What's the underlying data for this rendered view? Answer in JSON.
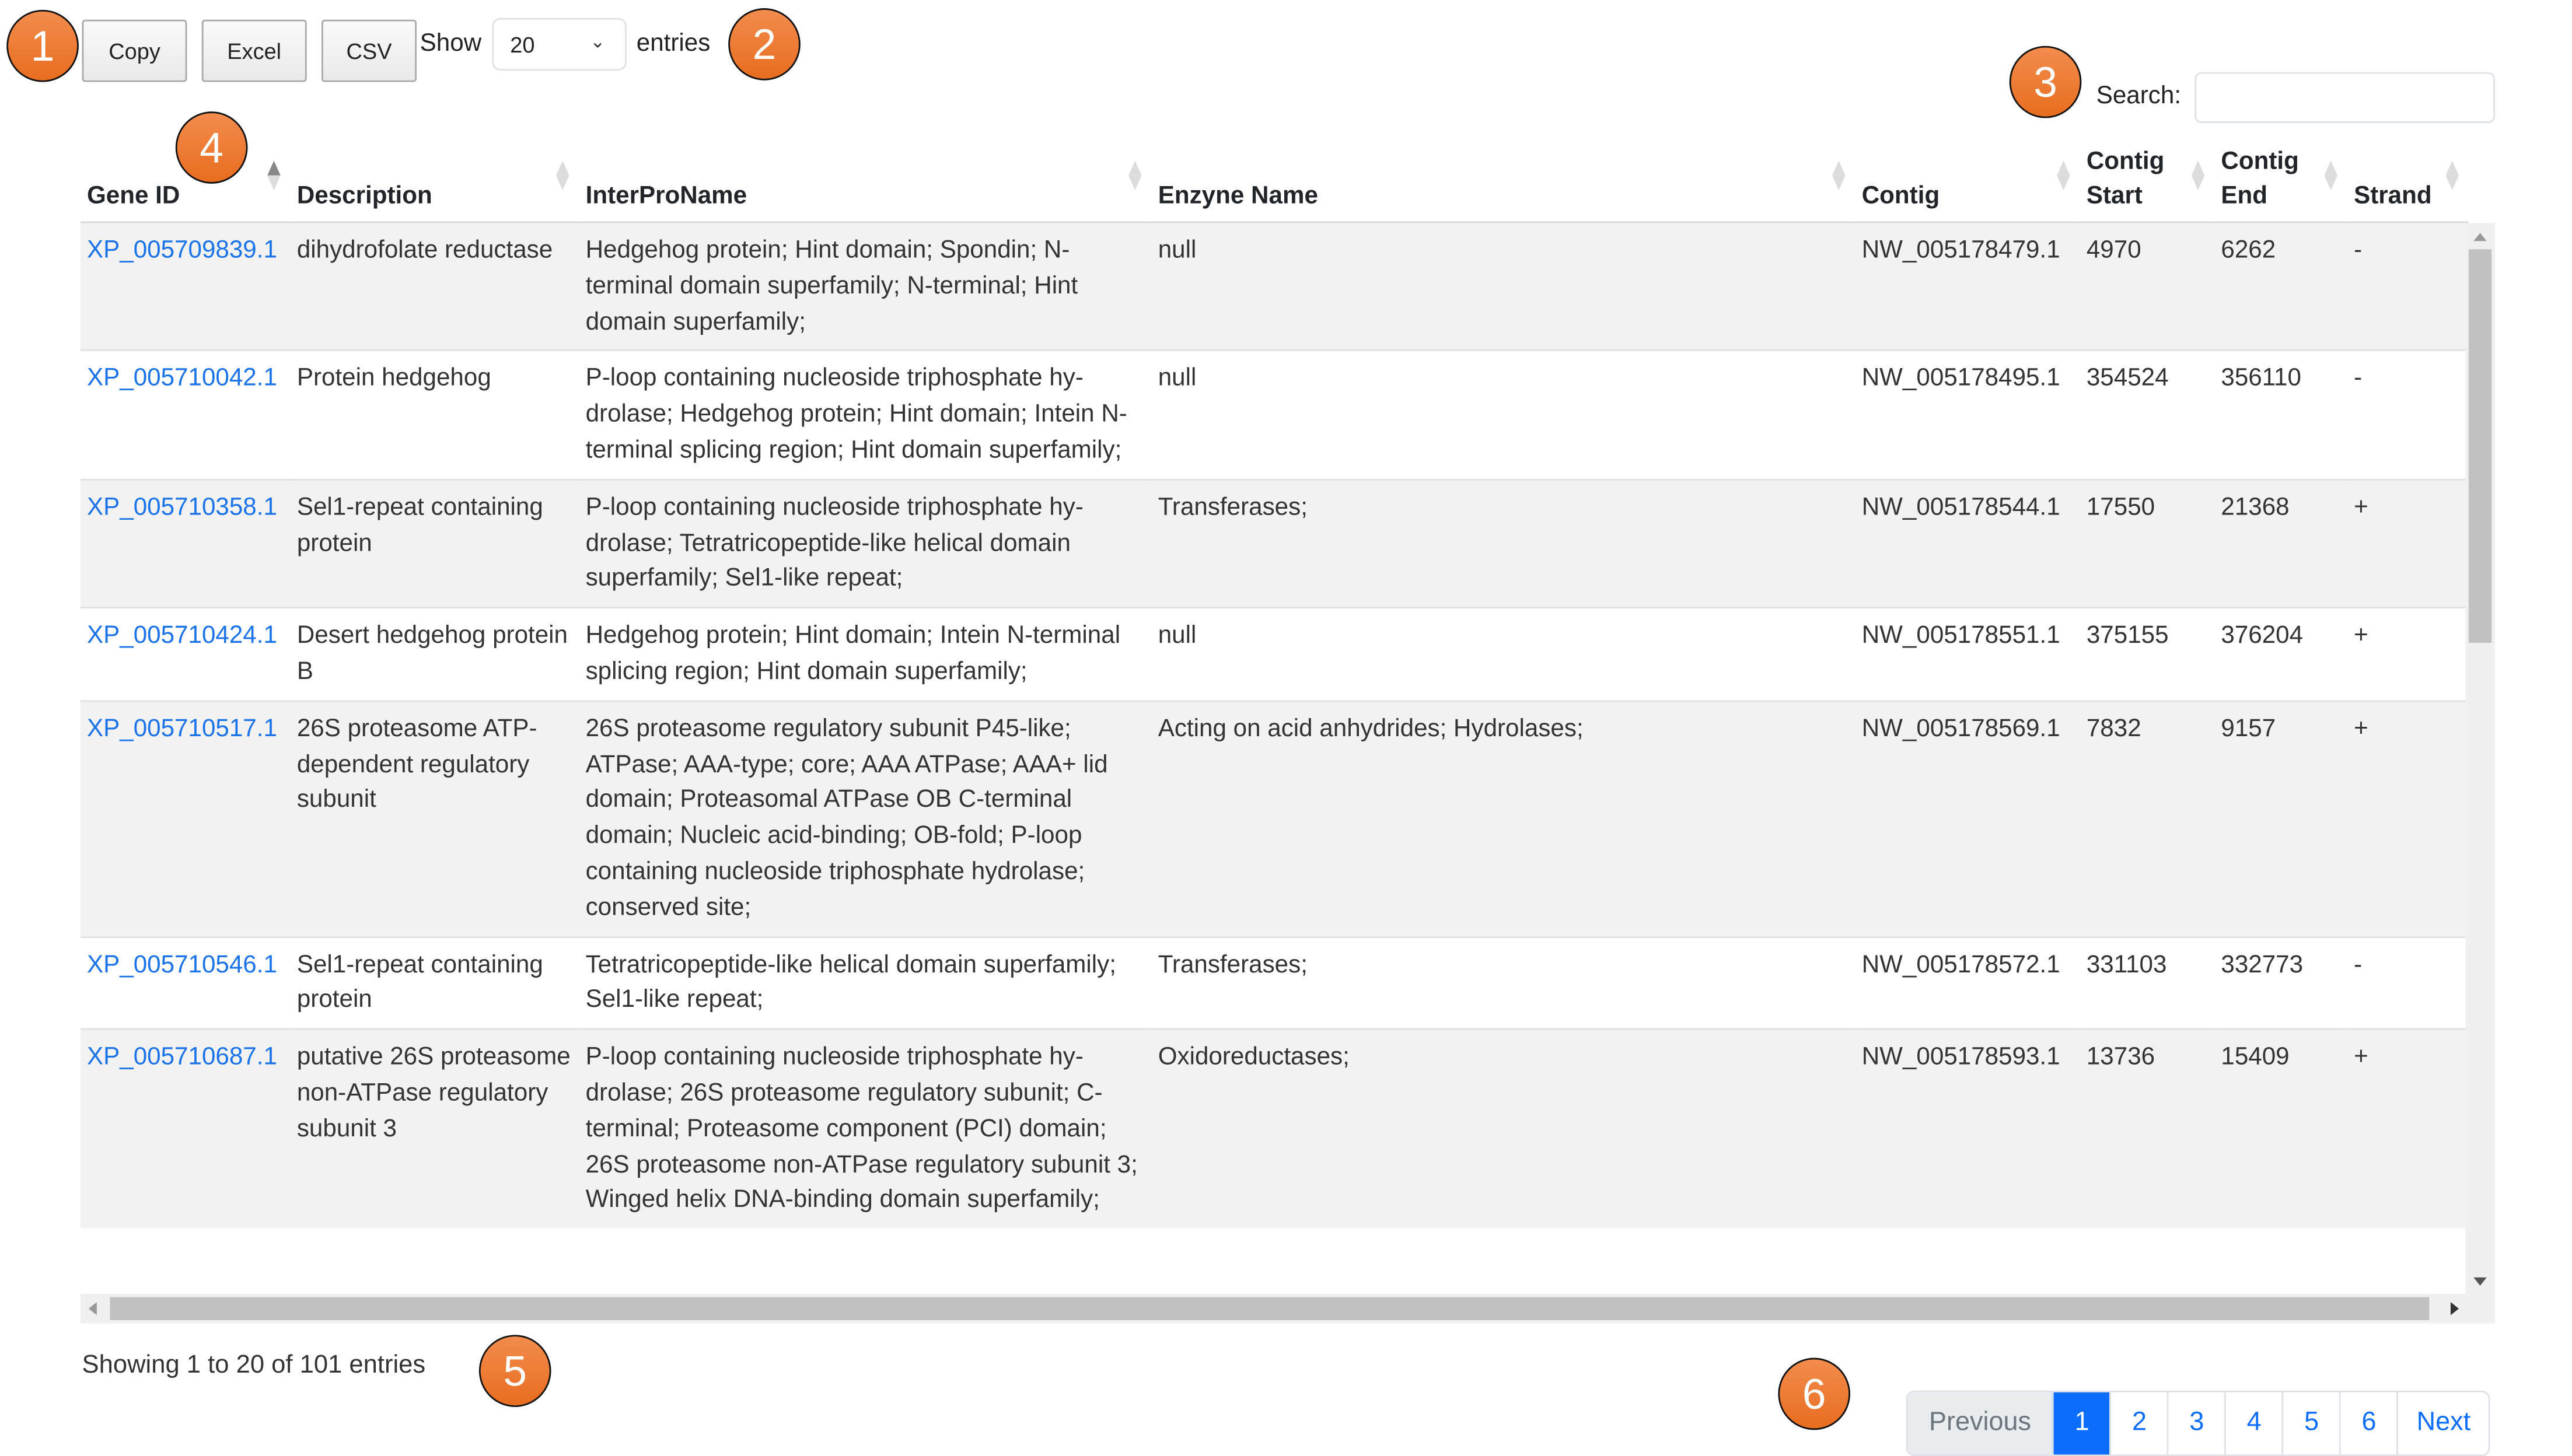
{
  "toolbar": {
    "buttons": [
      {
        "label": "Copy"
      },
      {
        "label": "Excel"
      },
      {
        "label": "CSV"
      }
    ],
    "show_label": "Show",
    "page_length_value": "20",
    "entries_label": "entries",
    "search_label": "Search:",
    "search_value": ""
  },
  "callouts": [
    "1",
    "2",
    "3",
    "4",
    "5",
    "6"
  ],
  "table": {
    "columns": [
      {
        "label": "Gene ID",
        "sort": "ascending"
      },
      {
        "label": "Description",
        "sort": "none"
      },
      {
        "label": "InterProName",
        "sort": "none"
      },
      {
        "label": "Enzyne Name",
        "sort": "none"
      },
      {
        "label": "Contig",
        "sort": "none"
      },
      {
        "label": "Contig Start",
        "sort": "none"
      },
      {
        "label": "Contig End",
        "sort": "none"
      },
      {
        "label": "Strand",
        "sort": "none"
      }
    ],
    "rows": [
      {
        "gene_id": "XP_005709839.1",
        "description": "dihydrofolate reductase",
        "interpro": "Hedgehog protein; Hint domain; Spondin; N-terminal domain superfamily; N-terminal; Hint domain superfamily;",
        "enzyme": "null",
        "contig": "NW_005178479.1",
        "start": "4970",
        "end": "6262",
        "strand": "-"
      },
      {
        "gene_id": "XP_005710042.1",
        "description": "Protein hedgehog",
        "interpro": "P-loop containing nucleoside triphosphate hy­drolase; Hedgehog protein; Hint domain; Intein N-terminal splicing region; Hint domain superfamily;",
        "enzyme": "null",
        "contig": "NW_005178495.1",
        "start": "354524",
        "end": "356110",
        "strand": "-"
      },
      {
        "gene_id": "XP_005710358.1",
        "description": "Sel1-repeat containing protein",
        "interpro": "P-loop containing nucleoside triphosphate hy­drolase; Tetratricopeptide-like helical domain superfamily; Sel1-like repeat;",
        "enzyme": "Transferases;",
        "contig": "NW_005178544.1",
        "start": "17550",
        "end": "21368",
        "strand": "+"
      },
      {
        "gene_id": "XP_005710424.1",
        "description": "Desert hedgehog pro­tein B",
        "interpro": "Hedgehog protein; Hint domain; Intein N-ter­minal splicing region; Hint domain superfamily;",
        "enzyme": "null",
        "contig": "NW_005178551.1",
        "start": "375155",
        "end": "376204",
        "strand": "+"
      },
      {
        "gene_id": "XP_005710517.1",
        "description": "26S proteasome ATP-dependent regulatory subunit",
        "interpro": "26S proteasome regulatory subunit P45-like; ATPase; AAA-type; core; AAA ATPase; AAA+ lid domain; Proteasomal ATPase OB C-terminal domain; Nucleic acid-binding; OB-fold; P-loop containing nucleoside triphosphate hydrolase; conserved site;",
        "enzyme": "Acting on acid anhydrides; Hydrolases;",
        "contig": "NW_005178569.1",
        "start": "7832",
        "end": "9157",
        "strand": "+"
      },
      {
        "gene_id": "XP_005710546.1",
        "description": "Sel1-repeat containing protein",
        "interpro": "Tetratricopeptide-like helical domain super­family; Sel1-like repeat;",
        "enzyme": "Transferases;",
        "contig": "NW_005178572.1",
        "start": "331103",
        "end": "332773",
        "strand": "-"
      },
      {
        "gene_id": "XP_005710687.1",
        "description": "putative 26S protea­some non-ATPase reg­ulatory subunit 3",
        "interpro": "P-loop containing nucleoside triphosphate hy­drolase; 26S proteasome regulatory subunit; C-terminal; Proteasome component (PCI) do­main; 26S proteasome non-ATPase regulatory subunit 3; Winged helix DNA-binding domain superfamily;",
        "enzyme": "Oxidoreductases;",
        "contig": "NW_005178593.1",
        "start": "13736",
        "end": "15409",
        "strand": "+"
      }
    ]
  },
  "footer": {
    "info": "Showing 1 to 20 of 101 entries",
    "pagination": {
      "previous_label": "Previous",
      "next_label": "Next",
      "pages": [
        "1",
        "2",
        "3",
        "4",
        "5",
        "6"
      ],
      "current_page": "1"
    }
  },
  "colors": {
    "link": "#1a73e8",
    "active_page": "#0d6efd",
    "callout": "#ee7a2f",
    "stripe": "#f2f2f2"
  }
}
